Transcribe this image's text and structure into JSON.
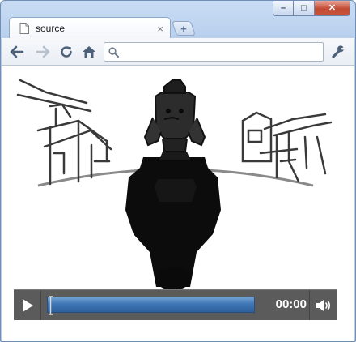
{
  "tab": {
    "title": "source",
    "close_glyph": "×"
  },
  "new_tab": {
    "glyph": "+"
  },
  "window_controls": {
    "minimize": "–",
    "maximize": "□",
    "close": "✕"
  },
  "address_bar": {
    "value": "",
    "placeholder": ""
  },
  "icons": {
    "back": "back-arrow-icon",
    "forward": "forward-arrow-icon",
    "reload": "reload-icon",
    "home": "home-icon",
    "search": "search-icon",
    "wrench": "wrench-icon",
    "play": "play-icon",
    "volume": "volume-icon"
  },
  "video": {
    "current_time": "00:00",
    "progress": 0
  },
  "colors": {
    "timeline_fill": "#3f76b5",
    "controls_bg": "#5b5b5b",
    "close_button": "#c24a33"
  }
}
